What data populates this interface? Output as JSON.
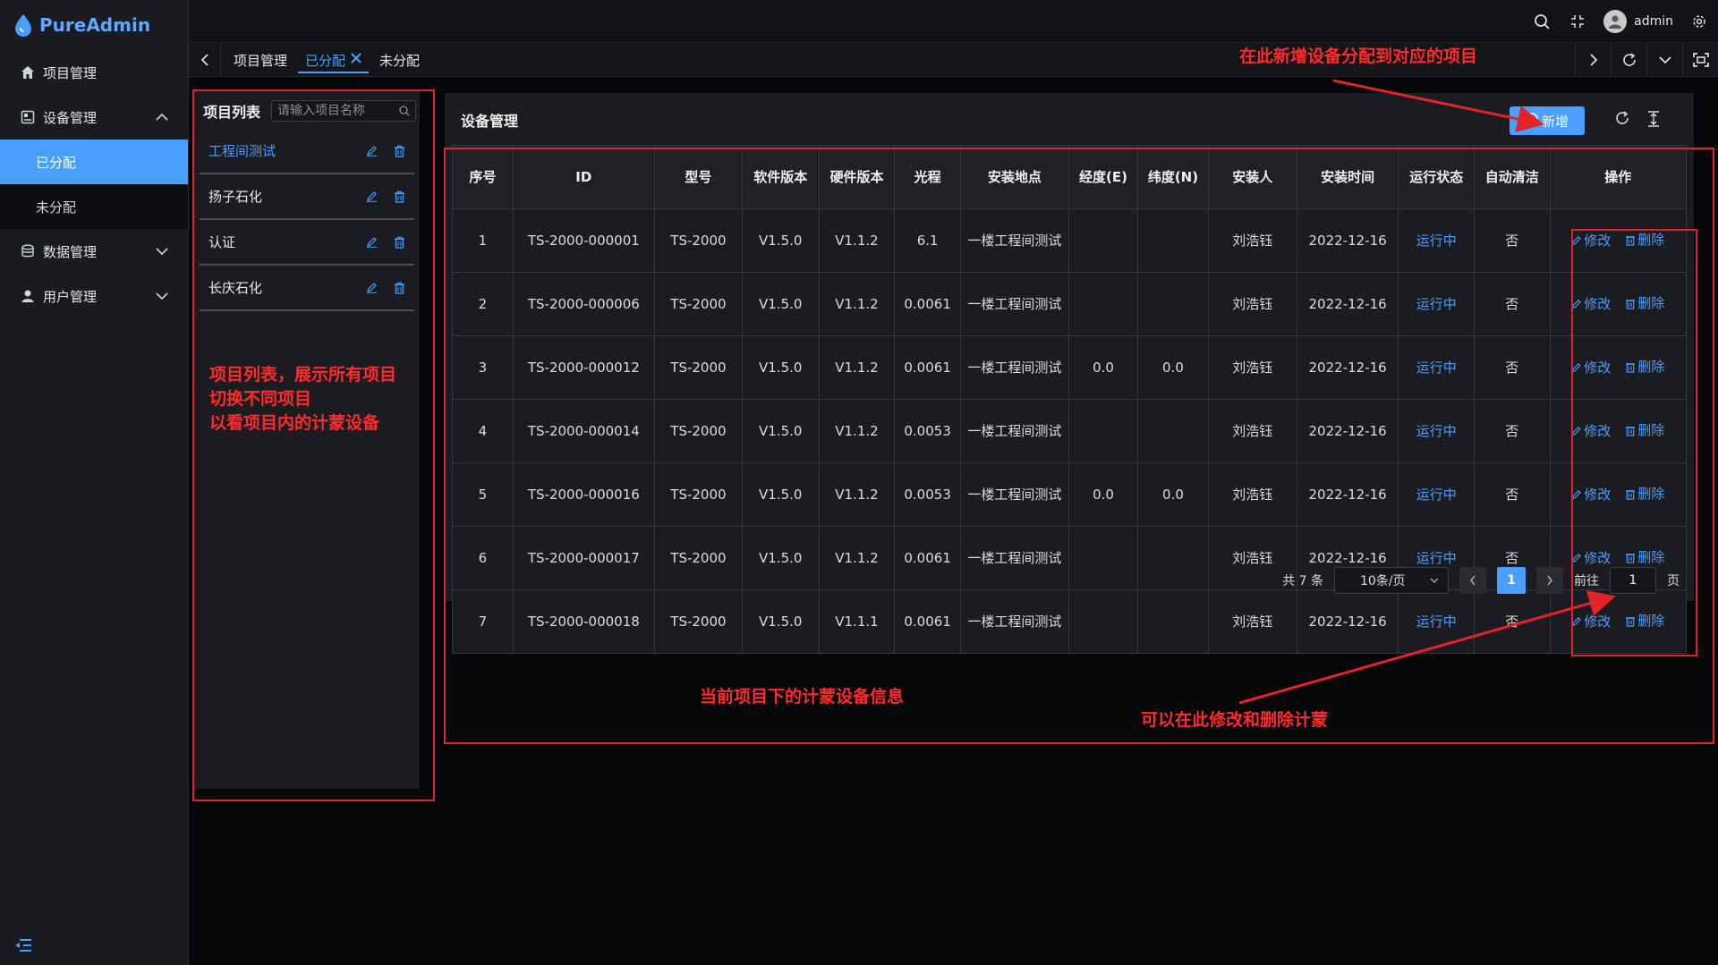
{
  "app": {
    "name": "PureAdmin"
  },
  "sidebar": {
    "items": [
      {
        "label": "项目管理",
        "icon": "home-icon"
      },
      {
        "label": "设备管理",
        "icon": "device-icon",
        "expanded": true,
        "children": [
          {
            "label": "已分配",
            "active": true
          },
          {
            "label": "未分配"
          }
        ]
      },
      {
        "label": "数据管理",
        "icon": "database-icon"
      },
      {
        "label": "用户管理",
        "icon": "user-icon"
      }
    ]
  },
  "topbar": {
    "user": "admin"
  },
  "tabs": [
    {
      "label": "项目管理"
    },
    {
      "label": "已分配",
      "active": true
    },
    {
      "label": "未分配"
    }
  ],
  "project_list": {
    "title": "项目列表",
    "search_placeholder": "请输入项目名称",
    "items": [
      {
        "name": "工程间测试",
        "active": true
      },
      {
        "name": "扬子石化"
      },
      {
        "name": "认证"
      },
      {
        "name": "长庆石化"
      }
    ]
  },
  "device_card": {
    "title": "设备管理",
    "add_label": "新增",
    "columns": [
      "序号",
      "ID",
      "型号",
      "软件版本",
      "硬件版本",
      "光程",
      "安装地点",
      "经度(E)",
      "纬度(N)",
      "安装人",
      "安装时间",
      "运行状态",
      "自动清洁",
      "操作"
    ],
    "edit_label": "修改",
    "delete_label": "删除",
    "rows": [
      {
        "no": "1",
        "id": "TS-2000-000001",
        "model": "TS-2000",
        "sw": "V1.5.0",
        "hw": "V1.1.2",
        "path": "6.1",
        "location": "一楼工程间测试",
        "lng": "",
        "lat": "",
        "installer": "刘浩钰",
        "date": "2022-12-16",
        "status": "运行中",
        "clean": "否"
      },
      {
        "no": "2",
        "id": "TS-2000-000006",
        "model": "TS-2000",
        "sw": "V1.5.0",
        "hw": "V1.1.2",
        "path": "0.0061",
        "location": "一楼工程间测试",
        "lng": "",
        "lat": "",
        "installer": "刘浩钰",
        "date": "2022-12-16",
        "status": "运行中",
        "clean": "否"
      },
      {
        "no": "3",
        "id": "TS-2000-000012",
        "model": "TS-2000",
        "sw": "V1.5.0",
        "hw": "V1.1.2",
        "path": "0.0061",
        "location": "一楼工程间测试",
        "lng": "0.0",
        "lat": "0.0",
        "installer": "刘浩钰",
        "date": "2022-12-16",
        "status": "运行中",
        "clean": "否"
      },
      {
        "no": "4",
        "id": "TS-2000-000014",
        "model": "TS-2000",
        "sw": "V1.5.0",
        "hw": "V1.1.2",
        "path": "0.0053",
        "location": "一楼工程间测试",
        "lng": "",
        "lat": "",
        "installer": "刘浩钰",
        "date": "2022-12-16",
        "status": "运行中",
        "clean": "否"
      },
      {
        "no": "5",
        "id": "TS-2000-000016",
        "model": "TS-2000",
        "sw": "V1.5.0",
        "hw": "V1.1.2",
        "path": "0.0053",
        "location": "一楼工程间测试",
        "lng": "0.0",
        "lat": "0.0",
        "installer": "刘浩钰",
        "date": "2022-12-16",
        "status": "运行中",
        "clean": "否"
      },
      {
        "no": "6",
        "id": "TS-2000-000017",
        "model": "TS-2000",
        "sw": "V1.5.0",
        "hw": "V1.1.2",
        "path": "0.0061",
        "location": "一楼工程间测试",
        "lng": "",
        "lat": "",
        "installer": "刘浩钰",
        "date": "2022-12-16",
        "status": "运行中",
        "clean": "否"
      },
      {
        "no": "7",
        "id": "TS-2000-000018",
        "model": "TS-2000",
        "sw": "V1.5.0",
        "hw": "V1.1.1",
        "path": "0.0061",
        "location": "一楼工程间测试",
        "lng": "",
        "lat": "",
        "installer": "刘浩钰",
        "date": "2022-12-16",
        "status": "运行中",
        "clean": "否"
      }
    ]
  },
  "pagination": {
    "total": "共 7 条",
    "page_size": "10条/页",
    "current": "1",
    "goto_label": "前往",
    "goto_value": "1",
    "page_suffix": "页"
  },
  "annotations": {
    "add_hint": "在此新增设备分配到对应的项目",
    "list_hint_1": "项目列表，展示所有项目",
    "list_hint_2": "切换不同项目",
    "list_hint_3": "以看项目内的计蒙设备",
    "table_hint": "当前项目下的计蒙设备信息",
    "ops_hint": "可以在此修改和删除计蒙",
    "color": "#ff2a2a"
  },
  "colors": {
    "accent": "#4a9eff",
    "annotation": "#e0242a"
  }
}
